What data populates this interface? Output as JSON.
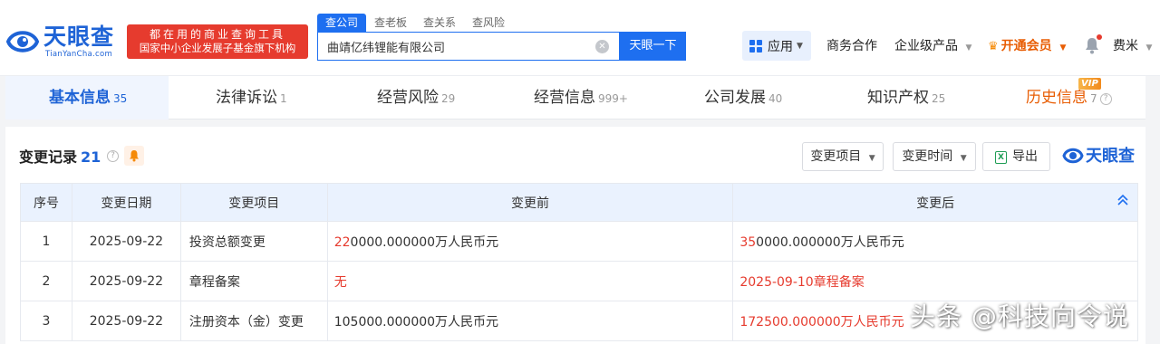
{
  "brand": {
    "name": "天眼查",
    "domain": "TianYanCha.com",
    "slogan_line1": "都在用的商业查询工具",
    "slogan_line2": "国家中小企业发展子基金旗下机构"
  },
  "search": {
    "tabs": [
      "查公司",
      "查老板",
      "查关系",
      "查风险"
    ],
    "active_tab": 0,
    "value": "曲靖亿纬锂能有限公司",
    "button_label": "天眼一下"
  },
  "nav": {
    "apps": "应用",
    "business": "商务合作",
    "enterprise": "企业级产品",
    "vip": "开通会员",
    "user": "费米"
  },
  "module_tabs": [
    {
      "label": "基本信息",
      "count": "35"
    },
    {
      "label": "法律诉讼",
      "count": "1"
    },
    {
      "label": "经营风险",
      "count": "29"
    },
    {
      "label": "经营信息",
      "count": "999+"
    },
    {
      "label": "公司发展",
      "count": "40"
    },
    {
      "label": "知识产权",
      "count": "25"
    },
    {
      "label": "历史信息",
      "count": "7"
    }
  ],
  "vip_badge": "VIP",
  "section": {
    "title": "变更记录",
    "count": "21",
    "filter_item": "变更项目",
    "filter_time": "变更时间",
    "export": "导出",
    "brand_mark": "天眼查"
  },
  "table": {
    "headers": [
      "序号",
      "变更日期",
      "变更项目",
      "变更前",
      "变更后"
    ],
    "rows": [
      {
        "no": "1",
        "date": "2025-09-22",
        "item": "投资总额变更",
        "before_hl": "22",
        "before_rest": "0000.000000万人民币元",
        "after_hl": "35",
        "after_rest": "0000.000000万人民币元"
      },
      {
        "no": "2",
        "date": "2025-09-22",
        "item": "章程备案",
        "before_hl": "无",
        "before_rest": "",
        "after_hl": "2025-09-10章程备案",
        "after_rest": ""
      },
      {
        "no": "3",
        "date": "2025-09-22",
        "item": "注册资本（金）变更",
        "before_hl": "",
        "before_rest": "105000.000000万人民币元",
        "after_hl": "172500.000000万人民币元",
        "after_rest": ""
      }
    ]
  },
  "watermark": "头条 @科技向令说",
  "colors": {
    "primary": "#1e6ff0",
    "brand_blue": "#1e63d6",
    "highlight_red": "#e63b2e",
    "vip_orange": "#e85d04",
    "header_row_bg": "#eaf2fe"
  }
}
